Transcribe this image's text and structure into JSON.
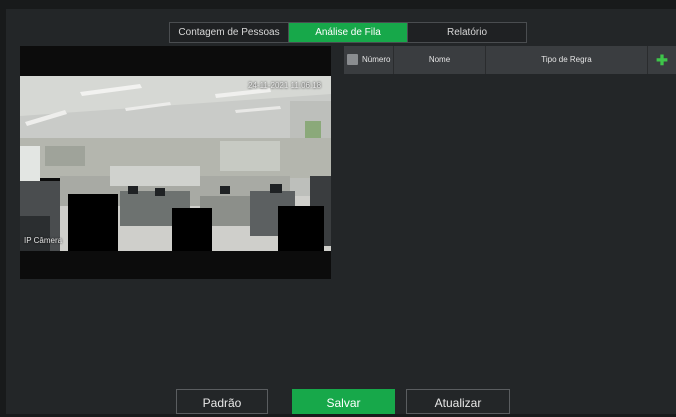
{
  "tabs": [
    {
      "label": "Contagem de Pessoas",
      "active": false
    },
    {
      "label": "Análise de Fila",
      "active": true
    },
    {
      "label": "Relatório",
      "active": false
    }
  ],
  "video": {
    "timestamp": "24-11-2021 11:06:18",
    "camera_label": "IP Câmera"
  },
  "table": {
    "columns": {
      "number": "Número",
      "name": "Nome",
      "rule_type": "Tipo de Regra"
    },
    "add_icon": "plus-icon",
    "rows": []
  },
  "buttons": {
    "default": "Padrão",
    "save": "Salvar",
    "refresh": "Atualizar"
  },
  "colors": {
    "accent": "#17a84a",
    "background": "#181a1b",
    "panel": "#232628"
  }
}
